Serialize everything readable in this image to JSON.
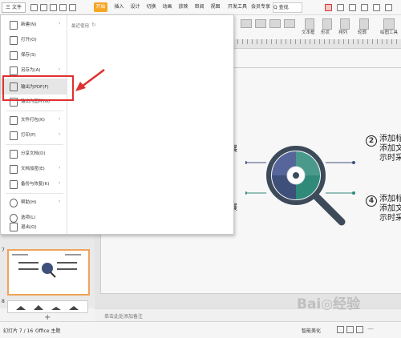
{
  "tabbar": {
    "menu_label": "三 文件",
    "start_btn": "开始",
    "tabs": [
      "开始",
      "插入",
      "设计",
      "切换",
      "动画",
      "放映",
      "审阅",
      "视图",
      "开发工具",
      "会员专享"
    ],
    "search": "Q 查找"
  },
  "toolbar": {
    "textbox": "文本框",
    "shape": "形状",
    "arrange": "排列",
    "outline": "轮廓",
    "slide_tools": "幻灯片",
    "drawing_tools": "绘图工具"
  },
  "file_menu": {
    "items": [
      {
        "label": "新建(N)",
        "arrow": "›"
      },
      {
        "label": "打开(O)",
        "arrow": ""
      },
      {
        "label": "保存(S)",
        "arrow": ""
      },
      {
        "label": "另存为(A)",
        "arrow": "›"
      },
      {
        "label": "输出为PDF(F)",
        "arrow": ""
      },
      {
        "label": "输出为图片(G)",
        "arrow": ""
      },
      {
        "label": "文件打包(K)",
        "arrow": "›"
      },
      {
        "label": "打印(P)",
        "arrow": "›"
      },
      {
        "label": "分享文档(D)",
        "arrow": ""
      },
      {
        "label": "文档加密(E)",
        "arrow": "›"
      },
      {
        "label": "备份与恢复(K)",
        "arrow": "›"
      },
      {
        "label": "帮助(H)",
        "arrow": "›"
      },
      {
        "label": "选项(L)",
        "arrow": ""
      },
      {
        "label": "退出(Q)",
        "arrow": ""
      }
    ],
    "recent_label": "最近使用"
  },
  "thumbnails": {
    "slide7_number": "7",
    "slide8_number": "8"
  },
  "slide": {
    "left_text_1": "展",
    "left_text_2": "展",
    "item2_number": "2",
    "item2_lines": [
      "添加标",
      "添加文",
      "示时采"
    ],
    "item4_number": "4",
    "item4_lines": [
      "添加标",
      "添加文",
      "示时采"
    ]
  },
  "notes": {
    "placeholder": "单击此处添加备注"
  },
  "status": {
    "slide_count": "幻灯片 7 / 16",
    "theme": "Office 主题",
    "smart_beautify": "智能美化",
    "add_slide": "+"
  },
  "colors": {
    "accent": "#f5a623",
    "annotation": "#e03030",
    "magnifier_dark": "#3c4a5a",
    "teal": "#2f8a7a",
    "navy": "#3e4f7a"
  }
}
